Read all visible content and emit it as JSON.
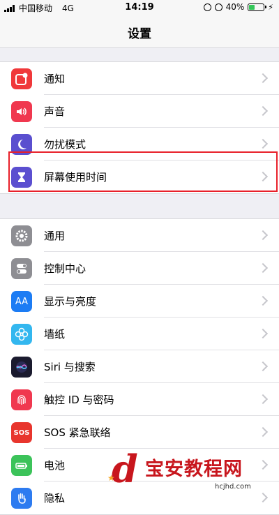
{
  "status": {
    "carrier": "中国移动",
    "network": "4G",
    "time": "14:19",
    "battery": "40%",
    "battery_level": 0.4
  },
  "nav": {
    "title": "设置"
  },
  "group1": [
    {
      "label": "通知",
      "icon": "notification-icon",
      "color": "#f0383a"
    },
    {
      "label": "声音",
      "icon": "sound-icon",
      "color": "#f0384f"
    },
    {
      "label": "勿扰模式",
      "icon": "moon-icon",
      "color": "#5a4fcf"
    },
    {
      "label": "屏幕使用时间",
      "icon": "hourglass-icon",
      "color": "#5b4fd0"
    }
  ],
  "group2": [
    {
      "label": "通用",
      "icon": "gear-icon",
      "color": "#8e8e93"
    },
    {
      "label": "控制中心",
      "icon": "toggles-icon",
      "color": "#8e8e93"
    },
    {
      "label": "显示与亮度",
      "icon": "display-brightness-icon",
      "color": "#1c7cf4"
    },
    {
      "label": "墙纸",
      "icon": "flower-icon",
      "color": "#33b7ef"
    },
    {
      "label": "Siri 与搜索",
      "icon": "siri-icon",
      "color": "#1a1a2e"
    },
    {
      "label": "触控 ID 与密码",
      "icon": "fingerprint-icon",
      "color": "#f0384f"
    },
    {
      "label": "SOS 紧急联络",
      "icon": "sos-icon",
      "color": "#e8352d"
    },
    {
      "label": "电池",
      "icon": "battery-icon",
      "color": "#3cc35a"
    },
    {
      "label": "隐私",
      "icon": "hand-icon",
      "color": "#2d7bf0"
    }
  ],
  "icon_glyphs": {
    "aa": "AA",
    "sos": "SOS"
  },
  "watermark": {
    "logo": "d",
    "text": "宝安教程网",
    "url": "hcjhd.com"
  }
}
